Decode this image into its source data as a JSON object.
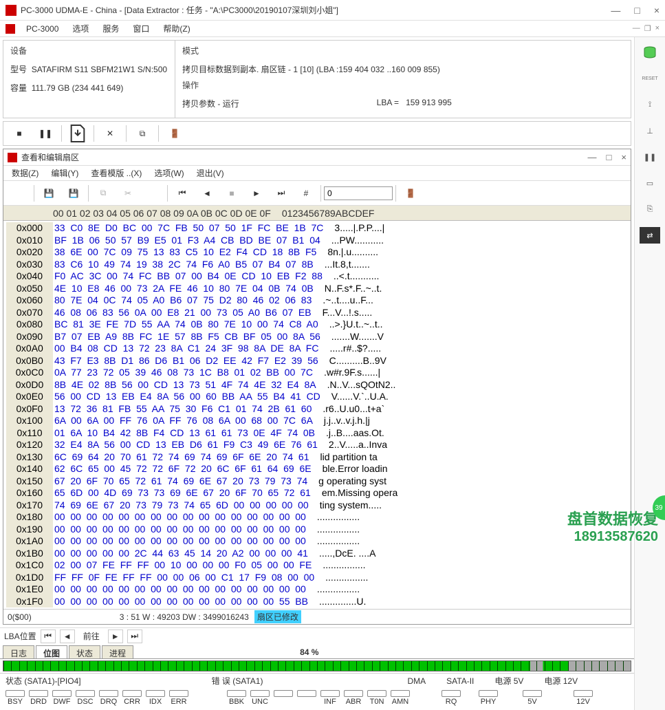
{
  "window": {
    "title": "PC-3000 UDMA-E - China - [Data Extractor : 任务 - \"A:\\PC3000\\20190107深圳刘小姐\"]",
    "app_name": "PC-3000",
    "minimize": "—",
    "maximize": "□",
    "close": "×"
  },
  "menu1": {
    "items": [
      "PC-3000",
      "选项",
      "服务",
      "窗口",
      "帮助(Z)"
    ]
  },
  "device": {
    "section": "设备",
    "model_label": "型号",
    "model": "SATAFIRM   S11 SBFM21W1 S/N:500",
    "capacity_label": "容量",
    "capacity": "111.79 GB (234 441 649)"
  },
  "mode": {
    "section": "模式",
    "text": "拷贝目标数据到副本. 扇区链 - 1 [10] (LBA :159 404 032 ..160 009 855)"
  },
  "operation": {
    "section": "操作",
    "text": "拷贝参数 - 运行",
    "lba_label": "LBA  =",
    "lba": "159 913 995"
  },
  "hexwin": {
    "title": "查看和编辑扇区",
    "menu": [
      "数据(Z)",
      "编辑(Y)",
      "查看模版 ..(X)",
      "选项(W)",
      "退出(V)"
    ],
    "input": "0",
    "header_cols": "00  01  02  03  04  05  06  07  08  09  0A  0B  0C  0D  0E  0F",
    "header_ascii": "0123456789ABCDEF"
  },
  "hexrows": [
    {
      "o": "0x000",
      "h": "33 C0 8E D0 BC 00 7C FB 50 07 50 1F FC BE 1B 7C",
      "a": "3.....|.P.P....|"
    },
    {
      "o": "0x010",
      "h": "BF 1B 06 50 57 B9 E5 01 F3 A4 CB BD BE 07 B1 04",
      "a": "...PW..........."
    },
    {
      "o": "0x020",
      "h": "38 6E 00 7C 09 75 13 83 C5 10 E2 F4 CD 18 8B F5",
      "a": "8n.|.u.........."
    },
    {
      "o": "0x030",
      "h": "83 C6 10 49 74 19 38 2C 74 F6 A0 B5 07 B4 07 8B",
      "a": "...It.8,t......."
    },
    {
      "o": "0x040",
      "h": "F0 AC 3C 00 74 FC BB 07 00 B4 0E CD 10 EB F2 88",
      "a": "..<.t..........."
    },
    {
      "o": "0x050",
      "h": "4E 10 E8 46 00 73 2A FE 46 10 80 7E 04 0B 74 0B",
      "a": "N..F.s*.F..~..t."
    },
    {
      "o": "0x060",
      "h": "80 7E 04 0C 74 05 A0 B6 07 75 D2 80 46 02 06 83",
      "a": ".~..t....u..F..."
    },
    {
      "o": "0x070",
      "h": "46 08 06 83 56 0A 00 E8 21 00 73 05 A0 B6 07 EB",
      "a": "F...V...!.s....."
    },
    {
      "o": "0x080",
      "h": "BC 81 3E FE 7D 55 AA 74 0B 80 7E 10 00 74 C8 A0",
      "a": "..>.}U.t..~..t.."
    },
    {
      "o": "0x090",
      "h": "B7 07 EB A9 8B FC 1E 57 8B F5 CB BF 05 00 8A 56",
      "a": ".......W.......V"
    },
    {
      "o": "0x0A0",
      "h": "00 B4 08 CD 13 72 23 8A C1 24 3F 98 8A DE 8A FC",
      "a": ".....r#..$?....."
    },
    {
      "o": "0x0B0",
      "h": "43 F7 E3 8B D1 86 D6 B1 06 D2 EE 42 F7 E2 39 56",
      "a": "C..........B..9V"
    },
    {
      "o": "0x0C0",
      "h": "0A 77 23 72 05 39 46 08 73 1C B8 01 02 BB 00 7C",
      "a": ".w#r.9F.s......|"
    },
    {
      "o": "0x0D0",
      "h": "8B 4E 02 8B 56 00 CD 13 73 51 4F 74 4E 32 E4 8A",
      "a": ".N..V...sQOtN2.."
    },
    {
      "o": "0x0E0",
      "h": "56 00 CD 13 EB E4 8A 56 00 60 BB AA 55 B4 41 CD",
      "a": "V......V.`..U.A."
    },
    {
      "o": "0x0F0",
      "h": "13 72 36 81 FB 55 AA 75 30 F6 C1 01 74 2B 61 60",
      "a": ".r6..U.u0...t+a`"
    },
    {
      "o": "0x100",
      "h": "6A 00 6A 00 FF 76 0A FF 76 08 6A 00 68 00 7C 6A",
      "a": "j.j..v..v.j.h.|j"
    },
    {
      "o": "0x110",
      "h": "01 6A 10 B4 42 8B F4 CD 13 61 61 73 0E 4F 74 0B",
      "a": ".j..B....aas.Ot."
    },
    {
      "o": "0x120",
      "h": "32 E4 8A 56 00 CD 13 EB D6 61 F9 C3 49 6E 76 61",
      "a": "2..V.....a..Inva"
    },
    {
      "o": "0x130",
      "h": "6C 69 64 20 70 61 72 74 69 74 69 6F 6E 20 74 61",
      "a": "lid partition ta"
    },
    {
      "o": "0x140",
      "h": "62 6C 65 00 45 72 72 6F 72 20 6C 6F 61 64 69 6E",
      "a": "ble.Error loadin"
    },
    {
      "o": "0x150",
      "h": "67 20 6F 70 65 72 61 74 69 6E 67 20 73 79 73 74",
      "a": "g operating syst"
    },
    {
      "o": "0x160",
      "h": "65 6D 00 4D 69 73 73 69 6E 67 20 6F 70 65 72 61",
      "a": "em.Missing opera"
    },
    {
      "o": "0x170",
      "h": "74 69 6E 67 20 73 79 73 74 65 6D 00 00 00 00 00",
      "a": "ting system....."
    },
    {
      "o": "0x180",
      "h": "00 00 00 00 00 00 00 00 00 00 00 00 00 00 00 00",
      "a": "................"
    },
    {
      "o": "0x190",
      "h": "00 00 00 00 00 00 00 00 00 00 00 00 00 00 00 00",
      "a": "................"
    },
    {
      "o": "0x1A0",
      "h": "00 00 00 00 00 00 00 00 00 00 00 00 00 00 00 00",
      "a": "................"
    },
    {
      "o": "0x1B0",
      "h": "00 00 00 00 00 2C 44 63 45 14 20 A2 00 00 00 41",
      "a": ".....,DcE. ....A"
    },
    {
      "o": "0x1C0",
      "h": "02 00 07 FE FF FF 00 10 00 00 00 F0 05 00 00 FE",
      "a": "................"
    },
    {
      "o": "0x1D0",
      "h": "FF FF 0F FE FF FF 00 00 06 00 C1 17 F9 08 00 00",
      "a": "................"
    },
    {
      "o": "0x1E0",
      "h": "00 00 00 00 00 00 00 00 00 00 00 00 00 00 00 00",
      "a": "................"
    },
    {
      "o": "0x1F0",
      "h": "00 00 00 00 00 00 00 00 00 00 00 00 00 00 55 BB",
      "a": "..............U."
    }
  ],
  "hexstat": {
    "pos": "0($00)",
    "bwd": "3 : 51 W : 49203 DW : 3499016243",
    "modified": "扇区已修改",
    "lba_label": "LBA位置",
    "goto": "前往"
  },
  "tabs": {
    "items": [
      "日志",
      "位图",
      "状态",
      "进程"
    ],
    "active": 1,
    "percent": "84 %"
  },
  "status": {
    "left": "状态 (SATA1)-[PIO4]",
    "err": "错 误 (SATA1)",
    "dma": "DMA",
    "sata2": "SATA-II",
    "p5v": "电源 5V",
    "p12v": "电源 12V"
  },
  "flags": {
    "g1": [
      "BSY",
      "DRD",
      "DWF",
      "DSC",
      "DRQ",
      "CRR",
      "IDX",
      "ERR"
    ],
    "g2": [
      "BBK",
      "UNC",
      "",
      "",
      "INF",
      "ABR",
      "T0N",
      "AMN"
    ],
    "g3": [
      "RQ"
    ],
    "g4": [
      "PHY"
    ],
    "g5": [
      "5V"
    ],
    "g6": [
      "12V"
    ]
  },
  "watermark": {
    "l1": "盘首数据恢复",
    "l2": "18913587620"
  },
  "badge": "39"
}
